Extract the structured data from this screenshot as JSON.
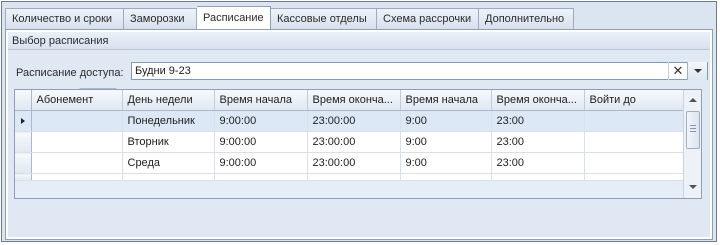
{
  "tabs": [
    {
      "label": "Количество и сроки"
    },
    {
      "label": "Заморозки"
    },
    {
      "label": "Расписание",
      "active": true
    },
    {
      "label": "Кассовые отделы"
    },
    {
      "label": "Схема рассрочки"
    },
    {
      "label": "Дополнительно"
    }
  ],
  "group": {
    "title": "Выбор расписания"
  },
  "access": {
    "label": "Расписание доступа:",
    "value": "Будни 9-23",
    "clear_symbol": "✕"
  },
  "toolbar": {
    "print_icon": "printer-icon",
    "preview_icon": "print-preview-icon"
  },
  "grid": {
    "columns": [
      "Абонемент",
      "День недели",
      "Время начала",
      "Время оконча...",
      "Время начала",
      "Время оконча...",
      "Войти до"
    ],
    "rows": [
      [
        "",
        "Понедельник",
        "9:00:00",
        "23:00:00",
        "9:00",
        "23:00",
        ""
      ],
      [
        "",
        "Вторник",
        "9:00:00",
        "23:00:00",
        "9:00",
        "23:00",
        ""
      ],
      [
        "",
        "Среда",
        "9:00:00",
        "23:00:00",
        "9:00",
        "23:00",
        ""
      ],
      [
        "",
        "",
        "",
        "",
        "",
        "",
        ""
      ]
    ],
    "selected_row": 0
  },
  "colors": {
    "frame_bg": "#dbe5f1",
    "selected_row": "#dde8f6",
    "border": "#8da0ba"
  }
}
